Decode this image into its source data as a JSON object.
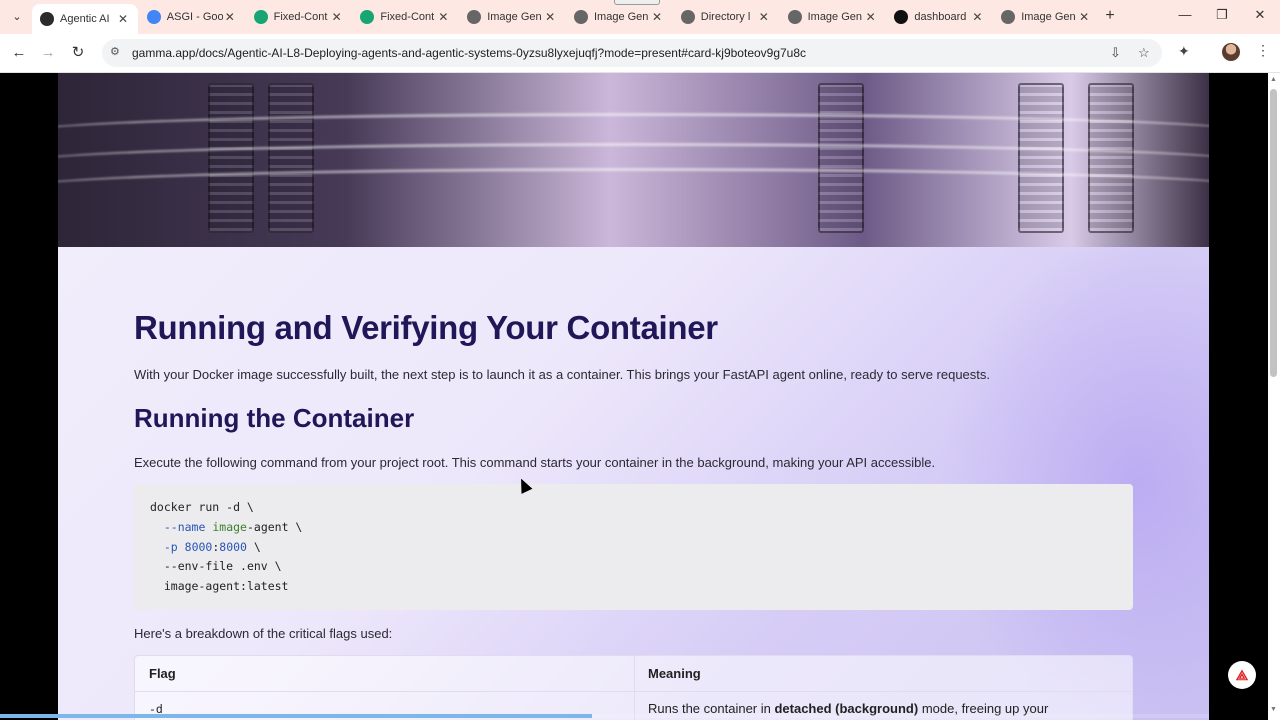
{
  "browser": {
    "tabs": [
      {
        "label": "Agentic AI",
        "favicon": "gamma-icon",
        "fav_color": "#2b2b2b",
        "active": true
      },
      {
        "label": "ASGI - Goo",
        "favicon": "google-icon",
        "fav_color": "#4285f4",
        "active": false
      },
      {
        "label": "Fixed-Cont",
        "favicon": "app-icon",
        "fav_color": "#17a673",
        "active": false
      },
      {
        "label": "Fixed-Cont",
        "favicon": "app-icon",
        "fav_color": "#17a673",
        "active": false
      },
      {
        "label": "Image Gen",
        "favicon": "globe-icon",
        "fav_color": "#666666",
        "active": false
      },
      {
        "label": "Image Gen",
        "favicon": "globe-icon",
        "fav_color": "#666666",
        "active": false
      },
      {
        "label": "Directory l",
        "favicon": "globe-icon",
        "fav_color": "#666666",
        "active": false
      },
      {
        "label": "Image Gen",
        "favicon": "globe-icon",
        "fav_color": "#666666",
        "active": false
      },
      {
        "label": "dashboard",
        "favicon": "notion-icon",
        "fav_color": "#111111",
        "active": false
      },
      {
        "label": "Image Gen",
        "favicon": "globe-icon",
        "fav_color": "#666666",
        "active": false
      }
    ],
    "url": "gamma.app/docs/Agentic-AI-L8-Deploying-agents-and-agentic-systems-0yzsu8lyxejuqfj?mode=present#card-kj9boteov9g7u8c"
  },
  "doc": {
    "title": "Running and Verifying Your Container",
    "intro": "With your Docker image successfully built, the next step is to launch it as a container. This brings your FastAPI agent online, ready to serve requests.",
    "subheading": "Running the Container",
    "exec_text": "Execute the following command from your project root. This command starts your container in the background, making your API accessible.",
    "code": {
      "l1": "docker run -d \\",
      "l2_flag": "--name",
      "l2_val": "image",
      "l2_rest": "-agent \\",
      "l3_flag": "-p ",
      "l3_num1": "8000",
      "l3_colon": ":",
      "l3_num2": "8000",
      "l3_rest": " \\",
      "l4": "--env-file .env \\",
      "l5": "image-agent:latest"
    },
    "breakdown": "Here's a breakdown of the critical flags used:",
    "table": {
      "headers": [
        "Flag",
        "Meaning"
      ],
      "row1_flag": "-d",
      "row1_meaning_pre": "Runs the container in ",
      "row1_meaning_bold": "detached (background)",
      "row1_meaning_post": " mode, freeing up your"
    }
  },
  "scroll": {
    "thumb_fraction": 0.45
  },
  "progress": {
    "fraction": 0.49
  },
  "colors": {
    "heading": "#1f1757",
    "accent": "#2a54b8"
  }
}
